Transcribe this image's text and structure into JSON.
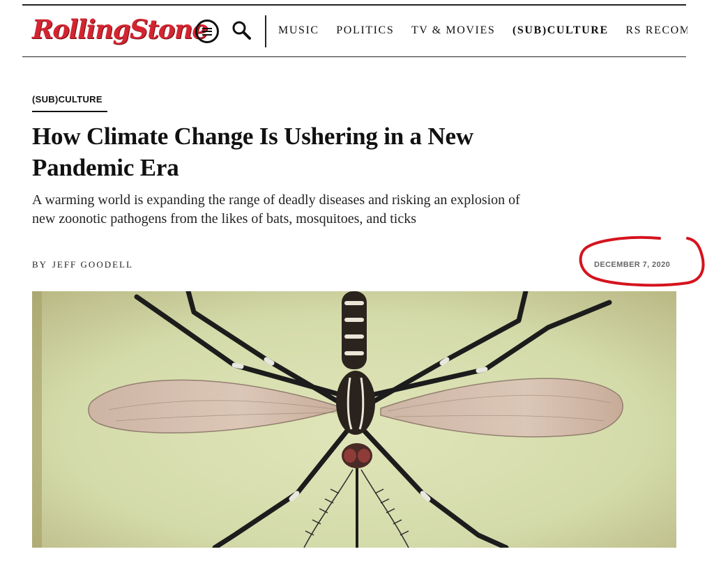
{
  "header": {
    "logo_text": "RollingStone",
    "nav_items": [
      {
        "label": "MUSIC"
      },
      {
        "label": "POLITICS"
      },
      {
        "label": "TV & MOVIES"
      },
      {
        "label": "(SUB)CULTURE",
        "active": true
      },
      {
        "label": "RS RECOMM"
      }
    ]
  },
  "article": {
    "category": "(SUB)CULTURE",
    "headline": "How Climate Change Is Ushering in a New Pandemic Era",
    "dek": "A warming world is expanding the range of deadly diseases and risking an explosion of new zoonotic pathogens from the likes of bats, mosquitoes, and ticks",
    "byline_prefix": "BY",
    "author": "JEFF GOODELL",
    "date": "DECEMBER 7, 2020"
  },
  "hero_image": {
    "subject": "mosquito illustration"
  },
  "colors": {
    "brand_red": "#d32531",
    "annotation_red": "#d4141e",
    "hero_background": "#d9dfb0"
  },
  "icons": {
    "menu": "menu-icon",
    "search": "search-icon"
  }
}
